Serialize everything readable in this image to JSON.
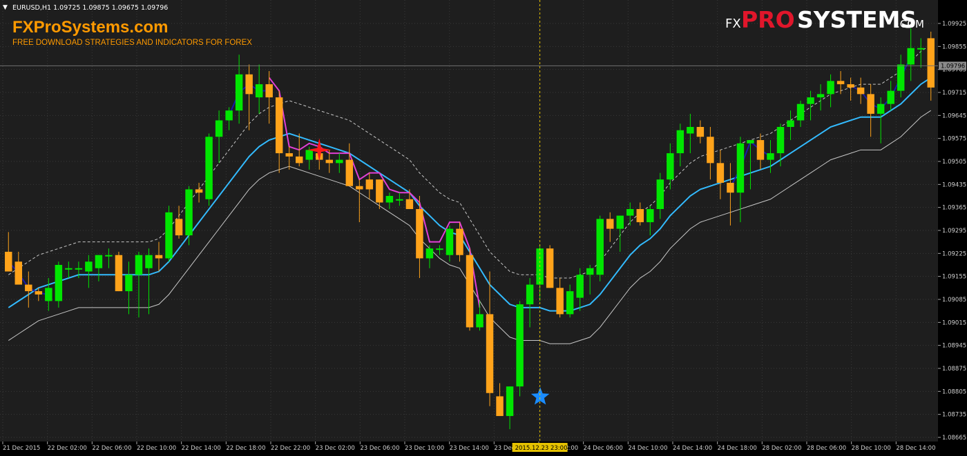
{
  "window": {
    "symbol_line": "EURUSD,H1  1.09725 1.09875 1.09675 1.09796"
  },
  "branding": {
    "site_name": "FXProSystems.com",
    "tagline": "FREE DOWNLOAD STRATEGIES AND INDICATORS FOR FOREX",
    "logo_fx": "FX",
    "logo_pro": "PRO",
    "logo_systems": "SYSTEMS",
    "logo_com": ".COM"
  },
  "colors": {
    "background": "#000000",
    "plot_bg": "#1e1e1e",
    "bull": "#00e600",
    "bear": "#ffa31a",
    "ma_fast": "#33bbff",
    "ma_trend": "#1a1aa8",
    "ma_sell": "#e23fd6",
    "envelope": "#c8c8c8",
    "crosshair": "#e6c200",
    "grid": "#3a3a3a",
    "sell_star": "#ff1a1a",
    "buy_star": "#1a8cff",
    "logo_red": "#e0162b",
    "brand_orange": "#ff9a00"
  },
  "price_axis": {
    "labels": [
      "1.09925",
      "1.09855",
      "1.09785",
      "1.09715",
      "1.09645",
      "1.09575",
      "1.09505",
      "1.09435",
      "1.09365",
      "1.09295",
      "1.09225",
      "1.09155",
      "1.09085",
      "1.09015",
      "1.08945",
      "1.08875",
      "1.08805",
      "1.08735",
      "1.08665"
    ],
    "current_price": "1.09796"
  },
  "time_axis": {
    "labels": [
      "21 Dec 2015",
      "22 Dec 02:00",
      "22 Dec 06:00",
      "22 Dec 10:00",
      "22 Dec 14:00",
      "22 Dec 18:00",
      "22 Dec 22:00",
      "23 Dec 02:00",
      "23 Dec 06:00",
      "23 Dec 10:00",
      "23 Dec 14:00",
      "23 Dec 18",
      "24 Dec 02:00",
      "24 Dec 06:00",
      "24 Dec 10:00",
      "24 Dec 14:00",
      "24 Dec 18:00",
      "28 Dec 02:00",
      "28 Dec 06:00",
      "28 Dec 10:00",
      "28 Dec 14:00"
    ],
    "crosshair_label": "2015.12.23 23:00"
  },
  "chart_data": {
    "type": "candlestick",
    "symbol": "EURUSD",
    "timeframe": "H1",
    "ylim": [
      1.08665,
      1.09925
    ],
    "candles": [
      {
        "o": 1.0923,
        "h": 1.0929,
        "l": 1.0917,
        "c": 1.0917
      },
      {
        "o": 1.092,
        "h": 1.0923,
        "l": 1.0915,
        "c": 1.0913
      },
      {
        "o": 1.0913,
        "h": 1.0917,
        "l": 1.0906,
        "c": 1.0911
      },
      {
        "o": 1.0911,
        "h": 1.0912,
        "l": 1.0908,
        "c": 1.091
      },
      {
        "o": 1.0908,
        "h": 1.0915,
        "l": 1.0905,
        "c": 1.0912
      },
      {
        "o": 1.0908,
        "h": 1.092,
        "l": 1.0906,
        "c": 1.0919
      },
      {
        "o": 1.0918,
        "h": 1.092,
        "l": 1.0915,
        "c": 1.0918
      },
      {
        "o": 1.0918,
        "h": 1.092,
        "l": 1.0915,
        "c": 1.0918
      },
      {
        "o": 1.0917,
        "h": 1.0922,
        "l": 1.0912,
        "c": 1.092
      },
      {
        "o": 1.0918,
        "h": 1.0922,
        "l": 1.0914,
        "c": 1.0922
      },
      {
        "o": 1.0922,
        "h": 1.0924,
        "l": 1.0918,
        "c": 1.0922
      },
      {
        "o": 1.0922,
        "h": 1.0923,
        "l": 1.0911,
        "c": 1.0911
      },
      {
        "o": 1.0911,
        "h": 1.092,
        "l": 1.0904,
        "c": 1.0916
      },
      {
        "o": 1.0916,
        "h": 1.0923,
        "l": 1.0903,
        "c": 1.0922
      },
      {
        "o": 1.0918,
        "h": 1.0924,
        "l": 1.0904,
        "c": 1.0922
      },
      {
        "o": 1.0922,
        "h": 1.0926,
        "l": 1.0917,
        "c": 1.0921
      },
      {
        "o": 1.0921,
        "h": 1.0937,
        "l": 1.092,
        "c": 1.0935
      },
      {
        "o": 1.0933,
        "h": 1.0937,
        "l": 1.0927,
        "c": 1.0928
      },
      {
        "o": 1.0928,
        "h": 1.0943,
        "l": 1.0925,
        "c": 1.0942
      },
      {
        "o": 1.0942,
        "h": 1.0944,
        "l": 1.0938,
        "c": 1.0941
      },
      {
        "o": 1.0939,
        "h": 1.0959,
        "l": 1.0937,
        "c": 1.0958
      },
      {
        "o": 1.0958,
        "h": 1.0966,
        "l": 1.095,
        "c": 1.0963
      },
      {
        "o": 1.0963,
        "h": 1.0967,
        "l": 1.096,
        "c": 1.0966
      },
      {
        "o": 1.0966,
        "h": 1.0983,
        "l": 1.0962,
        "c": 1.0977
      },
      {
        "o": 1.0977,
        "h": 1.098,
        "l": 1.096,
        "c": 1.0971
      },
      {
        "o": 1.097,
        "h": 1.098,
        "l": 1.0965,
        "c": 1.0974
      },
      {
        "o": 1.0974,
        "h": 1.0978,
        "l": 1.0962,
        "c": 1.097
      },
      {
        "o": 1.097,
        "h": 1.0972,
        "l": 1.0947,
        "c": 1.0953
      },
      {
        "o": 1.0953,
        "h": 1.0955,
        "l": 1.0948,
        "c": 1.0952
      },
      {
        "o": 1.0952,
        "h": 1.0959,
        "l": 1.0949,
        "c": 1.095
      },
      {
        "o": 1.0951,
        "h": 1.0955,
        "l": 1.0948,
        "c": 1.0954
      },
      {
        "o": 1.0953,
        "h": 1.0954,
        "l": 1.0948,
        "c": 1.0951
      },
      {
        "o": 1.0951,
        "h": 1.0954,
        "l": 1.0947,
        "c": 1.095
      },
      {
        "o": 1.095,
        "h": 1.0953,
        "l": 1.0947,
        "c": 1.0951
      },
      {
        "o": 1.0951,
        "h": 1.0956,
        "l": 1.0945,
        "c": 1.0943
      },
      {
        "o": 1.0943,
        "h": 1.0945,
        "l": 1.0932,
        "c": 1.0942
      },
      {
        "o": 1.0945,
        "h": 1.0947,
        "l": 1.0939,
        "c": 1.0942
      },
      {
        "o": 1.0945,
        "h": 1.0945,
        "l": 1.0936,
        "c": 1.0938
      },
      {
        "o": 1.0938,
        "h": 1.0941,
        "l": 1.0936,
        "c": 1.094
      },
      {
        "o": 1.0939,
        "h": 1.0941,
        "l": 1.0937,
        "c": 1.0939
      },
      {
        "o": 1.0939,
        "h": 1.0942,
        "l": 1.0936,
        "c": 1.0936
      },
      {
        "o": 1.0936,
        "h": 1.094,
        "l": 1.0915,
        "c": 1.0921
      },
      {
        "o": 1.0921,
        "h": 1.0925,
        "l": 1.0918,
        "c": 1.0924
      },
      {
        "o": 1.0924,
        "h": 1.0925,
        "l": 1.0922,
        "c": 1.0924
      },
      {
        "o": 1.0922,
        "h": 1.0931,
        "l": 1.092,
        "c": 1.093
      },
      {
        "o": 1.093,
        "h": 1.0932,
        "l": 1.092,
        "c": 1.0922
      },
      {
        "o": 1.0922,
        "h": 1.0924,
        "l": 1.0899,
        "c": 1.09
      },
      {
        "o": 1.09,
        "h": 1.0908,
        "l": 1.0899,
        "c": 1.0904
      },
      {
        "o": 1.0904,
        "h": 1.0917,
        "l": 1.0876,
        "c": 1.088
      },
      {
        "o": 1.0879,
        "h": 1.0883,
        "l": 1.0873,
        "c": 1.0873
      },
      {
        "o": 1.0873,
        "h": 1.0882,
        "l": 1.0869,
        "c": 1.0882
      },
      {
        "o": 1.0882,
        "h": 1.0908,
        "l": 1.0879,
        "c": 1.0907
      },
      {
        "o": 1.0907,
        "h": 1.0915,
        "l": 1.09,
        "c": 1.0913
      },
      {
        "o": 1.0913,
        "h": 1.0925,
        "l": 1.0908,
        "c": 1.0924
      },
      {
        "o": 1.0924,
        "h": 1.0925,
        "l": 1.0912,
        "c": 1.0912
      },
      {
        "o": 1.0912,
        "h": 1.0915,
        "l": 1.0903,
        "c": 1.0904
      },
      {
        "o": 1.0904,
        "h": 1.0913,
        "l": 1.0903,
        "c": 1.0911
      },
      {
        "o": 1.0909,
        "h": 1.0918,
        "l": 1.0905,
        "c": 1.0916
      },
      {
        "o": 1.0916,
        "h": 1.0919,
        "l": 1.091,
        "c": 1.0918
      },
      {
        "o": 1.0916,
        "h": 1.0934,
        "l": 1.0914,
        "c": 1.0933
      },
      {
        "o": 1.0933,
        "h": 1.0935,
        "l": 1.0926,
        "c": 1.093
      },
      {
        "o": 1.093,
        "h": 1.0934,
        "l": 1.0923,
        "c": 1.0934
      },
      {
        "o": 1.0934,
        "h": 1.0938,
        "l": 1.0931,
        "c": 1.0936
      },
      {
        "o": 1.0936,
        "h": 1.0938,
        "l": 1.0931,
        "c": 1.0932
      },
      {
        "o": 1.0932,
        "h": 1.0937,
        "l": 1.0928,
        "c": 1.0936
      },
      {
        "o": 1.0936,
        "h": 1.0947,
        "l": 1.0933,
        "c": 1.0945
      },
      {
        "o": 1.0945,
        "h": 1.0956,
        "l": 1.0942,
        "c": 1.0953
      },
      {
        "o": 1.0953,
        "h": 1.0962,
        "l": 1.0949,
        "c": 1.096
      },
      {
        "o": 1.0959,
        "h": 1.0965,
        "l": 1.0953,
        "c": 1.0961
      },
      {
        "o": 1.0961,
        "h": 1.0963,
        "l": 1.0956,
        "c": 1.0958
      },
      {
        "o": 1.0958,
        "h": 1.0961,
        "l": 1.0945,
        "c": 1.095
      },
      {
        "o": 1.095,
        "h": 1.0954,
        "l": 1.0939,
        "c": 1.0944
      },
      {
        "o": 1.0944,
        "h": 1.095,
        "l": 1.0931,
        "c": 1.0941
      },
      {
        "o": 1.0941,
        "h": 1.0958,
        "l": 1.0932,
        "c": 1.0956
      },
      {
        "o": 1.0956,
        "h": 1.0957,
        "l": 1.0942,
        "c": 1.0957
      },
      {
        "o": 1.0957,
        "h": 1.0959,
        "l": 1.0948,
        "c": 1.0951
      },
      {
        "o": 1.0951,
        "h": 1.0957,
        "l": 1.0947,
        "c": 1.0953
      },
      {
        "o": 1.0953,
        "h": 1.0962,
        "l": 1.0949,
        "c": 1.0961
      },
      {
        "o": 1.0961,
        "h": 1.0966,
        "l": 1.0957,
        "c": 1.0963
      },
      {
        "o": 1.0963,
        "h": 1.0969,
        "l": 1.0961,
        "c": 1.0968
      },
      {
        "o": 1.0968,
        "h": 1.0972,
        "l": 1.0963,
        "c": 1.097
      },
      {
        "o": 1.097,
        "h": 1.0974,
        "l": 1.0966,
        "c": 1.0971
      },
      {
        "o": 1.0971,
        "h": 1.0977,
        "l": 1.0967,
        "c": 1.0975
      },
      {
        "o": 1.0975,
        "h": 1.0978,
        "l": 1.0971,
        "c": 1.0974
      },
      {
        "o": 1.0974,
        "h": 1.0976,
        "l": 1.0969,
        "c": 1.0973
      },
      {
        "o": 1.0973,
        "h": 1.0976,
        "l": 1.0968,
        "c": 1.0971
      },
      {
        "o": 1.0971,
        "h": 1.0974,
        "l": 1.0958,
        "c": 1.0965
      },
      {
        "o": 1.0965,
        "h": 1.097,
        "l": 1.0956,
        "c": 1.0968
      },
      {
        "o": 1.0968,
        "h": 1.0975,
        "l": 1.0966,
        "c": 1.0972
      },
      {
        "o": 1.0972,
        "h": 1.0983,
        "l": 1.097,
        "c": 1.098
      },
      {
        "o": 1.098,
        "h": 1.0991,
        "l": 1.0975,
        "c": 1.0985
      },
      {
        "o": 1.0985,
        "h": 1.0988,
        "l": 1.0979,
        "c": 1.0985
      },
      {
        "o": 1.0988,
        "h": 1.099,
        "l": 1.0969,
        "c": 1.0973
      }
    ],
    "series": [
      {
        "name": "",
        "color_key": "ma_fast",
        "values": [
          1.0906,
          1.0908,
          1.091,
          1.0912,
          1.0913,
          1.0914,
          1.0915,
          1.0916,
          1.0916,
          1.0916,
          1.0916,
          1.0916,
          1.0916,
          1.0916,
          1.0916,
          1.0917,
          1.092,
          1.0924,
          1.0928,
          1.0932,
          1.0936,
          1.094,
          1.0944,
          1.0948,
          1.0952,
          1.0955,
          1.0957,
          1.0958,
          1.0959,
          1.0958,
          1.0957,
          1.0956,
          1.0955,
          1.0954,
          1.0953,
          1.0951,
          1.0949,
          1.0947,
          1.0945,
          1.0943,
          1.0941,
          1.0937,
          1.0934,
          1.0931,
          1.0929,
          1.0928,
          1.0923,
          1.0918,
          1.0913,
          1.091,
          1.0907,
          1.0906,
          1.0906,
          1.0906,
          1.0905,
          1.0905,
          1.0905,
          1.0906,
          1.0907,
          1.091,
          1.0914,
          1.0918,
          1.0922,
          1.0925,
          1.0927,
          1.093,
          1.0934,
          1.0937,
          1.094,
          1.0942,
          1.0943,
          1.0944,
          1.0945,
          1.0946,
          1.0947,
          1.0948,
          1.0949,
          1.0951,
          1.0953,
          1.0955,
          1.0957,
          1.0959,
          1.0961,
          1.0962,
          1.0963,
          1.0964,
          1.0964,
          1.0964,
          1.0966,
          1.0968,
          1.0971,
          1.0974,
          1.0976
        ]
      },
      {
        "name": "",
        "color_key": "envelope",
        "dashed": false,
        "values": [
          1.0896,
          1.0898,
          1.09,
          1.0902,
          1.0903,
          1.0904,
          1.0905,
          1.0906,
          1.0906,
          1.0906,
          1.0906,
          1.0906,
          1.0906,
          1.0906,
          1.0906,
          1.0907,
          1.091,
          1.0914,
          1.0918,
          1.0922,
          1.0926,
          1.093,
          1.0934,
          1.0938,
          1.0942,
          1.0945,
          1.0947,
          1.0948,
          1.0949,
          1.0948,
          1.0947,
          1.0946,
          1.0945,
          1.0944,
          1.0943,
          1.0941,
          1.0939,
          1.0937,
          1.0935,
          1.0933,
          1.0931,
          1.0927,
          1.0924,
          1.0921,
          1.0919,
          1.0918,
          1.0913,
          1.0908,
          1.0903,
          1.09,
          1.0897,
          1.0896,
          1.0896,
          1.0896,
          1.0895,
          1.0895,
          1.0895,
          1.0896,
          1.0897,
          1.09,
          1.0904,
          1.0908,
          1.0912,
          1.0915,
          1.0917,
          1.092,
          1.0924,
          1.0927,
          1.093,
          1.0932,
          1.0933,
          1.0934,
          1.0935,
          1.0936,
          1.0937,
          1.0938,
          1.0939,
          1.0941,
          1.0943,
          1.0945,
          1.0947,
          1.0949,
          1.0951,
          1.0952,
          1.0953,
          1.0954,
          1.0954,
          1.0954,
          1.0956,
          1.0958,
          1.0961,
          1.0964,
          1.0966
        ]
      },
      {
        "name": "",
        "color_key": "envelope",
        "dashed": true,
        "values": [
          1.0916,
          1.0918,
          1.092,
          1.0922,
          1.0923,
          1.0924,
          1.0925,
          1.0926,
          1.0926,
          1.0926,
          1.0926,
          1.0926,
          1.0926,
          1.0926,
          1.0926,
          1.0927,
          1.093,
          1.0934,
          1.0938,
          1.0942,
          1.0946,
          1.095,
          1.0954,
          1.0958,
          1.0962,
          1.0965,
          1.0967,
          1.0968,
          1.0969,
          1.0968,
          1.0967,
          1.0966,
          1.0965,
          1.0964,
          1.0963,
          1.0961,
          1.0959,
          1.0957,
          1.0955,
          1.0953,
          1.0951,
          1.0947,
          1.0944,
          1.0941,
          1.0939,
          1.0938,
          1.0933,
          1.0928,
          1.0923,
          1.092,
          1.0917,
          1.0916,
          1.0916,
          1.0916,
          1.0915,
          1.0915,
          1.0915,
          1.0916,
          1.0917,
          1.092,
          1.0924,
          1.0928,
          1.0932,
          1.0935,
          1.0937,
          1.094,
          1.0944,
          1.0947,
          1.095,
          1.0952,
          1.0953,
          1.0954,
          1.0955,
          1.0956,
          1.0957,
          1.0958,
          1.0959,
          1.0961,
          1.0963,
          1.0965,
          1.0967,
          1.0969,
          1.0971,
          1.0972,
          1.0973,
          1.0974,
          1.0974,
          1.0974,
          1.0976,
          1.0978,
          1.0981,
          1.0984,
          1.0986
        ]
      }
    ],
    "signals": [
      {
        "type": "sell",
        "candle_index": 31,
        "price": 1.0954
      },
      {
        "type": "buy",
        "candle_index": 52,
        "price": 1.0882
      }
    ],
    "crosshair_candle_index": 53
  }
}
